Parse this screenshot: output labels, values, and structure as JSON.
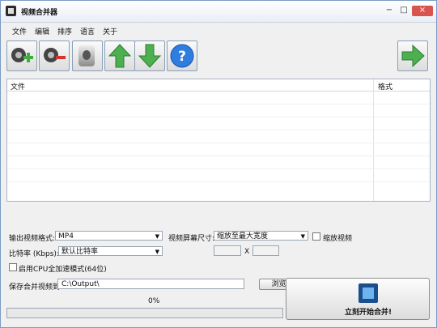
{
  "window": {
    "title": "视频合并器",
    "min": "−",
    "max": "□",
    "close": "×"
  },
  "menu": [
    "文件",
    "编辑",
    "排序",
    "语言",
    "关于"
  ],
  "list": {
    "col_file": "文件",
    "col_format": "格式"
  },
  "options": {
    "out_format_label": "输出视频格式:",
    "out_format_value": "MP4",
    "screen_size_label": "视频屏幕尺寸:",
    "screen_size_value": "缩放至最大宽度",
    "scale_video_label": "缩放视频",
    "bitrate_label": "比特率 (Kbps):",
    "bitrate_value": "默认比特率",
    "cross": "X",
    "cpu_label": "启用CPU全加速模式(64位)",
    "save_label": "保存合并视频到",
    "save_path": "C:\\Output\\",
    "browse_label": "浏览"
  },
  "progress": {
    "text": "0%",
    "value": 0
  },
  "merge_label": "立刻开始合并!",
  "icons": {
    "add": "add-video-icon",
    "remove": "remove-video-icon",
    "clear": "clear-list-icon",
    "up": "move-up-icon",
    "down": "move-down-icon",
    "help": "help-icon",
    "next": "next-icon"
  },
  "colors": {
    "green": "#4caf50",
    "help_blue": "#2f7de0",
    "title_border": "#7a9cc6"
  }
}
